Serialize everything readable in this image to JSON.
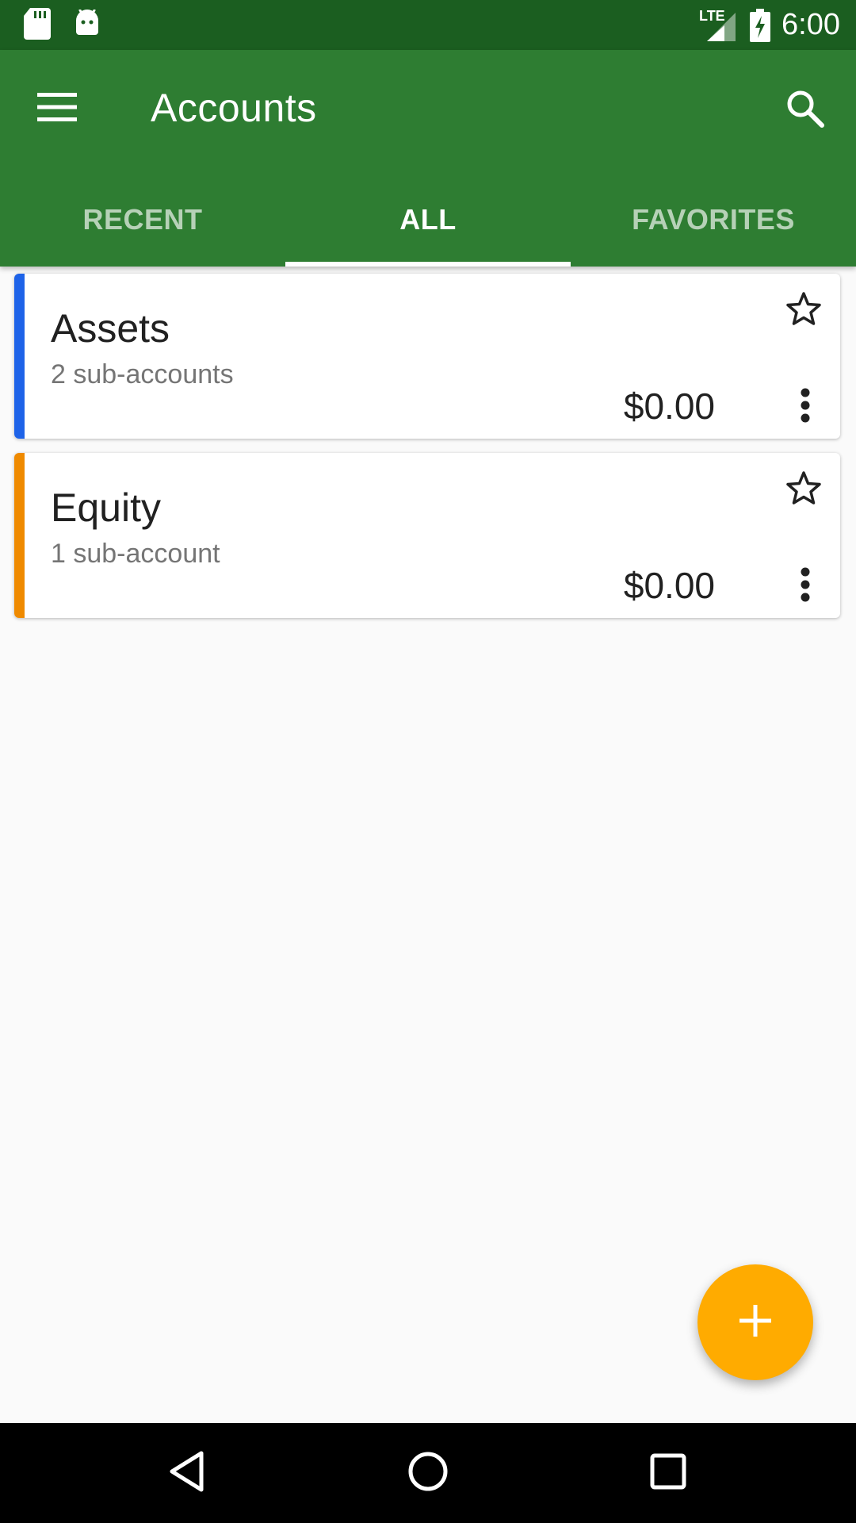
{
  "status_bar": {
    "time": "6:00",
    "network": "LTE",
    "icons": [
      "sd-card-icon",
      "android-icon",
      "signal-icon",
      "battery-charging-icon"
    ]
  },
  "app_bar": {
    "title": "Accounts",
    "menu_icon": "hamburger-menu-icon",
    "search_icon": "search-icon",
    "background_color": "#2e7d32",
    "status_bar_color": "#1b5e20"
  },
  "tabs": [
    {
      "label": "RECENT",
      "active": false
    },
    {
      "label": "ALL",
      "active": true
    },
    {
      "label": "FAVORITES",
      "active": false
    }
  ],
  "accounts": [
    {
      "name": "Assets",
      "subtitle": "2 sub-accounts",
      "balance": "$0.00",
      "color": "#1e63e8",
      "favorite": false
    },
    {
      "name": "Equity",
      "subtitle": "1 sub-account",
      "balance": "$0.00",
      "color": "#ef8a00",
      "favorite": false
    }
  ],
  "fab": {
    "icon": "plus-icon",
    "color": "#ffab00"
  },
  "nav_bar": {
    "icons": [
      "back-icon",
      "home-icon",
      "recents-icon"
    ]
  }
}
